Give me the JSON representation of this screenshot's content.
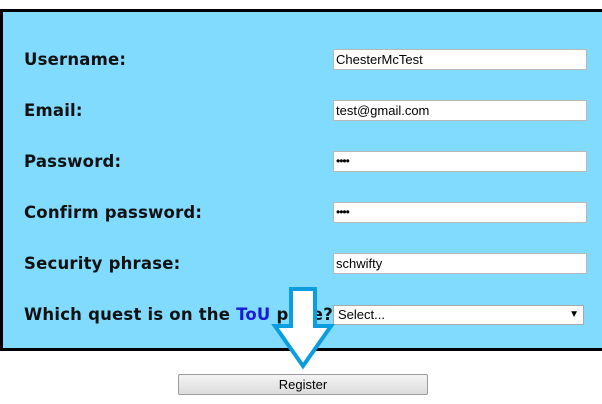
{
  "form": {
    "username_label": "Username:",
    "username_value": "ChesterMcTest",
    "email_label": "Email:",
    "email_value": "test@gmail.com",
    "password_label": "Password:",
    "password_value": "••••",
    "confirm_label": "Confirm password:",
    "confirm_value": "••••",
    "security_label": "Security phrase:",
    "security_value": "schwifty",
    "quest_label_prefix": "Which quest is on the ",
    "quest_label_link": "ToU",
    "quest_label_suffix": " page?",
    "quest_selected": "Select...",
    "quest_arrow": "▼"
  },
  "register_label": "Register",
  "colors": {
    "panel_bg": "#80dbff",
    "link": "#1a1ad6",
    "hint_arrow": "#0a9ee0"
  },
  "icons": {
    "select_arrow": "dropdown-caret-icon",
    "hint_arrow": "down-arrow-hint-icon"
  }
}
